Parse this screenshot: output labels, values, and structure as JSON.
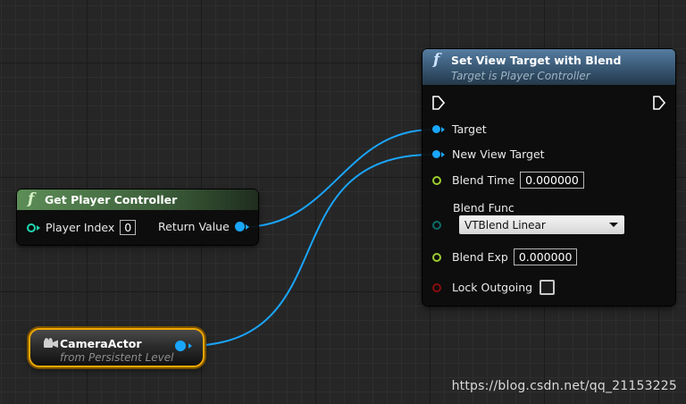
{
  "set_view_target": {
    "title": "Set View Target with Blend",
    "subtitle": "Target is Player Controller",
    "icon": "function-icon",
    "pins": {
      "target": "Target",
      "new_view_target": "New View Target",
      "blend_time": "Blend Time",
      "blend_time_value": "0.000000",
      "blend_func": "Blend Func",
      "blend_func_value": "VTBlend Linear",
      "blend_exp": "Blend Exp",
      "blend_exp_value": "0.000000",
      "lock_outgoing": "Lock Outgoing"
    }
  },
  "get_player_controller": {
    "title": "Get Player Controller",
    "icon": "function-icon",
    "player_index_label": "Player Index",
    "player_index_value": "0",
    "return_value_label": "Return Value"
  },
  "camera_actor": {
    "title": "CameraActor",
    "subtitle": "from Persistent Level",
    "icon": "camera-icon"
  },
  "watermark": "https://blog.csdn.net/qq_21153225",
  "colors": {
    "object_pin": "#1aa6ff",
    "float_pin": "#9ccc2f",
    "byte_pin": "#0d6b6b",
    "bool_pin": "#8b0d0d",
    "int_pin": "#1fd8b0",
    "selected_outline": "#f2a900",
    "function_header": "#3a5a78",
    "pure_function_header": "#4f7a4c"
  }
}
